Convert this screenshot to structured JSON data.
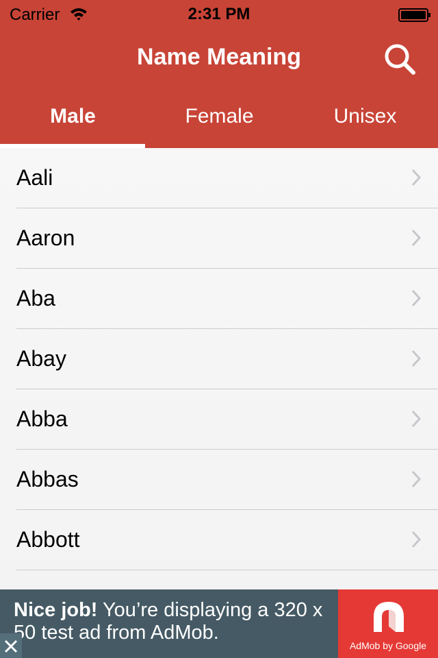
{
  "status_bar": {
    "carrier": "Carrier",
    "time": "2:31 PM"
  },
  "header": {
    "title": "Name Meaning"
  },
  "tabs": [
    {
      "label": "Male",
      "active": true
    },
    {
      "label": "Female",
      "active": false
    },
    {
      "label": "Unisex",
      "active": false
    }
  ],
  "names": [
    "Aali",
    "Aaron",
    "Aba",
    "Abay",
    "Abba",
    "Abbas",
    "Abbott"
  ],
  "ad": {
    "headline": "Nice job!",
    "body": " You’re displaying a 320 x 50 test ad from AdMob.",
    "brand": "AdMob by Google"
  },
  "colors": {
    "accent": "#c84437",
    "ad_background": "#455a64",
    "ad_logo": "#e53935"
  }
}
